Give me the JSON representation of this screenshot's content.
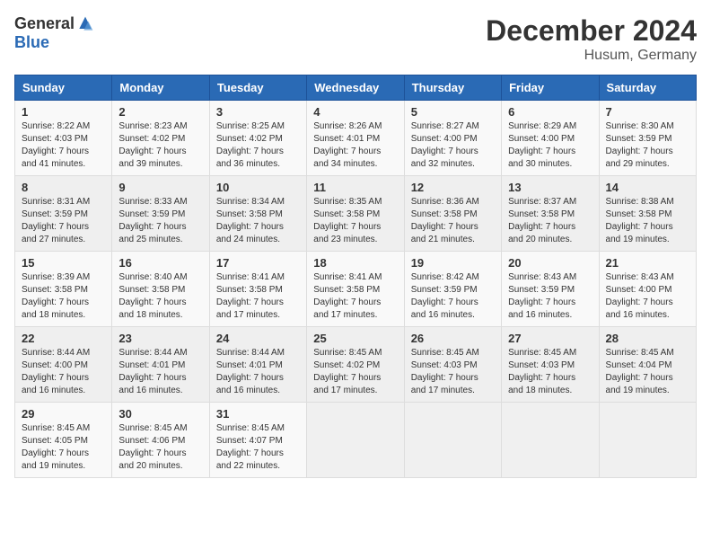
{
  "header": {
    "logo_general": "General",
    "logo_blue": "Blue",
    "month_title": "December 2024",
    "location": "Husum, Germany"
  },
  "weekdays": [
    "Sunday",
    "Monday",
    "Tuesday",
    "Wednesday",
    "Thursday",
    "Friday",
    "Saturday"
  ],
  "weeks": [
    [
      {
        "day": "1",
        "sunrise": "8:22 AM",
        "sunset": "4:03 PM",
        "daylight": "7 hours and 41 minutes."
      },
      {
        "day": "2",
        "sunrise": "8:23 AM",
        "sunset": "4:02 PM",
        "daylight": "7 hours and 39 minutes."
      },
      {
        "day": "3",
        "sunrise": "8:25 AM",
        "sunset": "4:02 PM",
        "daylight": "7 hours and 36 minutes."
      },
      {
        "day": "4",
        "sunrise": "8:26 AM",
        "sunset": "4:01 PM",
        "daylight": "7 hours and 34 minutes."
      },
      {
        "day": "5",
        "sunrise": "8:27 AM",
        "sunset": "4:00 PM",
        "daylight": "7 hours and 32 minutes."
      },
      {
        "day": "6",
        "sunrise": "8:29 AM",
        "sunset": "4:00 PM",
        "daylight": "7 hours and 30 minutes."
      },
      {
        "day": "7",
        "sunrise": "8:30 AM",
        "sunset": "3:59 PM",
        "daylight": "7 hours and 29 minutes."
      }
    ],
    [
      {
        "day": "8",
        "sunrise": "8:31 AM",
        "sunset": "3:59 PM",
        "daylight": "7 hours and 27 minutes."
      },
      {
        "day": "9",
        "sunrise": "8:33 AM",
        "sunset": "3:59 PM",
        "daylight": "7 hours and 25 minutes."
      },
      {
        "day": "10",
        "sunrise": "8:34 AM",
        "sunset": "3:58 PM",
        "daylight": "7 hours and 24 minutes."
      },
      {
        "day": "11",
        "sunrise": "8:35 AM",
        "sunset": "3:58 PM",
        "daylight": "7 hours and 23 minutes."
      },
      {
        "day": "12",
        "sunrise": "8:36 AM",
        "sunset": "3:58 PM",
        "daylight": "7 hours and 21 minutes."
      },
      {
        "day": "13",
        "sunrise": "8:37 AM",
        "sunset": "3:58 PM",
        "daylight": "7 hours and 20 minutes."
      },
      {
        "day": "14",
        "sunrise": "8:38 AM",
        "sunset": "3:58 PM",
        "daylight": "7 hours and 19 minutes."
      }
    ],
    [
      {
        "day": "15",
        "sunrise": "8:39 AM",
        "sunset": "3:58 PM",
        "daylight": "7 hours and 18 minutes."
      },
      {
        "day": "16",
        "sunrise": "8:40 AM",
        "sunset": "3:58 PM",
        "daylight": "7 hours and 18 minutes."
      },
      {
        "day": "17",
        "sunrise": "8:41 AM",
        "sunset": "3:58 PM",
        "daylight": "7 hours and 17 minutes."
      },
      {
        "day": "18",
        "sunrise": "8:41 AM",
        "sunset": "3:58 PM",
        "daylight": "7 hours and 17 minutes."
      },
      {
        "day": "19",
        "sunrise": "8:42 AM",
        "sunset": "3:59 PM",
        "daylight": "7 hours and 16 minutes."
      },
      {
        "day": "20",
        "sunrise": "8:43 AM",
        "sunset": "3:59 PM",
        "daylight": "7 hours and 16 minutes."
      },
      {
        "day": "21",
        "sunrise": "8:43 AM",
        "sunset": "4:00 PM",
        "daylight": "7 hours and 16 minutes."
      }
    ],
    [
      {
        "day": "22",
        "sunrise": "8:44 AM",
        "sunset": "4:00 PM",
        "daylight": "7 hours and 16 minutes."
      },
      {
        "day": "23",
        "sunrise": "8:44 AM",
        "sunset": "4:01 PM",
        "daylight": "7 hours and 16 minutes."
      },
      {
        "day": "24",
        "sunrise": "8:44 AM",
        "sunset": "4:01 PM",
        "daylight": "7 hours and 16 minutes."
      },
      {
        "day": "25",
        "sunrise": "8:45 AM",
        "sunset": "4:02 PM",
        "daylight": "7 hours and 17 minutes."
      },
      {
        "day": "26",
        "sunrise": "8:45 AM",
        "sunset": "4:03 PM",
        "daylight": "7 hours and 17 minutes."
      },
      {
        "day": "27",
        "sunrise": "8:45 AM",
        "sunset": "4:03 PM",
        "daylight": "7 hours and 18 minutes."
      },
      {
        "day": "28",
        "sunrise": "8:45 AM",
        "sunset": "4:04 PM",
        "daylight": "7 hours and 19 minutes."
      }
    ],
    [
      {
        "day": "29",
        "sunrise": "8:45 AM",
        "sunset": "4:05 PM",
        "daylight": "7 hours and 19 minutes."
      },
      {
        "day": "30",
        "sunrise": "8:45 AM",
        "sunset": "4:06 PM",
        "daylight": "7 hours and 20 minutes."
      },
      {
        "day": "31",
        "sunrise": "8:45 AM",
        "sunset": "4:07 PM",
        "daylight": "7 hours and 22 minutes."
      },
      null,
      null,
      null,
      null
    ]
  ]
}
